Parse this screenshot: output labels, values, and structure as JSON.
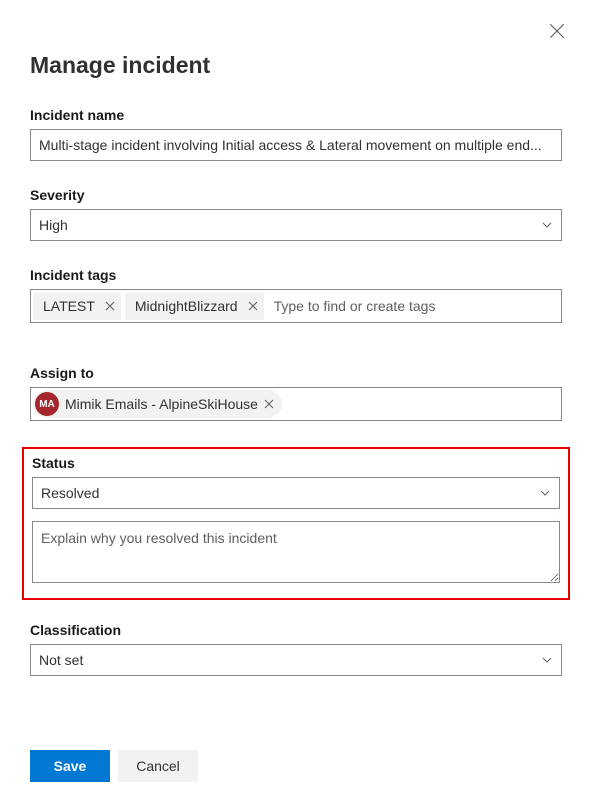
{
  "header": {
    "title": "Manage incident"
  },
  "fields": {
    "incident_name": {
      "label": "Incident name",
      "value": "Multi-stage incident involving Initial access & Lateral movement on multiple end..."
    },
    "severity": {
      "label": "Severity",
      "value": "High"
    },
    "tags": {
      "label": "Incident tags",
      "items": [
        "LATEST",
        "MidnightBlizzard"
      ],
      "placeholder": "Type to find or create tags"
    },
    "assign_to": {
      "label": "Assign to",
      "persona": {
        "initials": "MA",
        "name": "Mimik Emails - AlpineSkiHouse"
      }
    },
    "status": {
      "label": "Status",
      "value": "Resolved"
    },
    "resolution": {
      "placeholder": "Explain why you resolved this incident"
    },
    "classification": {
      "label": "Classification",
      "value": "Not set"
    }
  },
  "footer": {
    "save": "Save",
    "cancel": "Cancel"
  }
}
